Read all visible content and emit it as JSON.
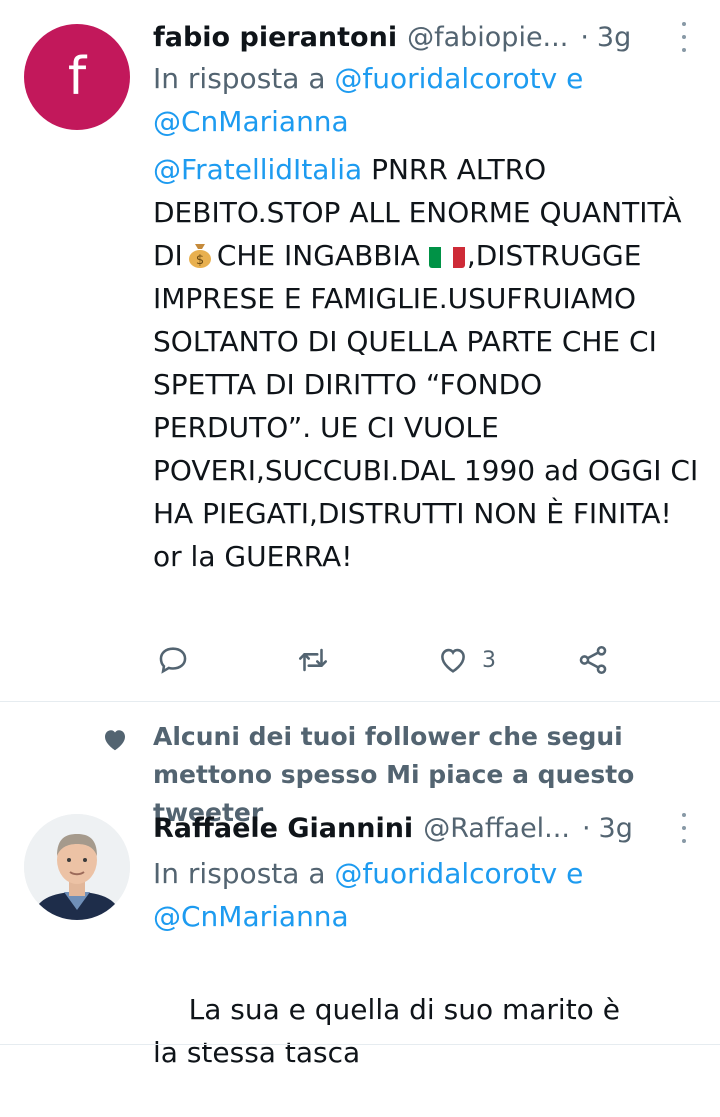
{
  "tweets": [
    {
      "avatar_letter": "f",
      "avatar_color": "#c2185b",
      "name": "fabio pierantoni",
      "handle": "@fabiopie...",
      "dot": "·",
      "time": "3g",
      "reply_prefix": "In risposta a",
      "reply_mention_1": "@fuoridalcorotv",
      "reply_conj": "e",
      "reply_mention_2": "@CnMarianna",
      "body_mention": "@FratellidItalia",
      "body_part_1": " PNRR ALTRO DEBITO.STOP ALL ENORME QUANTITÀ DI",
      "body_emoji_1": "money-bag-emoji",
      "body_part_2": "CHE INGABBIA ",
      "body_emoji_2": "italy-flag-emoji",
      "body_part_3": ",DISTRUGGE IMPRESE E FAMIGLIE.USUFRUIAMO SOLTANTO DI QUELLA PARTE CHE CI SPETTA DI DIRITTO “FONDO PERDUTO”. UE CI VUOLE POVERI,SUCCUBI.DAL 1990 ad OGGI CI HA PIEGATI,DISTRUTTI NON È FINITA! or la GUERRA!",
      "actions": {
        "reply_icon": "reply-icon",
        "retweet_icon": "retweet-icon",
        "like_icon": "heart-icon",
        "like_count": "3",
        "share_icon": "share-icon"
      }
    },
    {
      "social_context_icon": "heart-filled-icon",
      "social_context": "Alcuni dei tuoi follower che segui mettono spesso Mi piace a questo tweeter",
      "name": "Raffaele Giannini",
      "handle": "@Raffael...",
      "dot": "·",
      "time": "3g",
      "reply_prefix": "In risposta a",
      "reply_mention_1": "@fuoridalcorotv",
      "reply_conj": "e",
      "reply_mention_2": "@CnMarianna",
      "body": "La sua e quella di suo marito è la stessa tasca"
    }
  ],
  "colors": {
    "link": "#1d9bf0",
    "secondary": "#536471",
    "primary_text": "#0f1419"
  }
}
